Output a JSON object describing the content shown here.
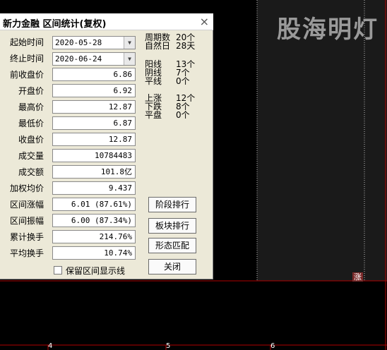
{
  "watermark": "股海明灯",
  "tag": "涨",
  "axis": {
    "labels": [
      "4",
      "5",
      "6"
    ]
  },
  "dialog": {
    "title": "新力金融 区间统计(复权)",
    "close": "×",
    "start_label": "起始时间",
    "start_value": "2020-05-28",
    "end_label": "终止时间",
    "end_value": "2020-06-24",
    "fields": [
      {
        "label": "前收盘价",
        "value": "6.86"
      },
      {
        "label": "开盘价",
        "value": "6.92"
      },
      {
        "label": "最高价",
        "value": "12.87"
      },
      {
        "label": "最低价",
        "value": "6.87"
      },
      {
        "label": "收盘价",
        "value": "12.87"
      },
      {
        "label": "成交量",
        "value": "10784483"
      },
      {
        "label": "成交额",
        "value": "101.8亿"
      },
      {
        "label": "加权均价",
        "value": "9.437"
      },
      {
        "label": "区间涨幅",
        "value": "6.01 (87.61%)"
      },
      {
        "label": "区间振幅",
        "value": "6.00 (87.34%)"
      },
      {
        "label": "累计换手",
        "value": "214.76%"
      },
      {
        "label": "平均换手",
        "value": "10.74%"
      }
    ],
    "period": [
      {
        "k": "周期数",
        "v": "20个"
      },
      {
        "k": "自然日",
        "v": "28天"
      }
    ],
    "lines": [
      {
        "k": "阳线",
        "v": "13个"
      },
      {
        "k": "阴线",
        "v": "7个"
      },
      {
        "k": "平线",
        "v": "0个"
      }
    ],
    "moves": [
      {
        "k": "上涨",
        "v": "12个"
      },
      {
        "k": "下跌",
        "v": "8个"
      },
      {
        "k": "平盘",
        "v": "0个"
      }
    ],
    "buttons": [
      "阶段排行",
      "板块排行",
      "形态匹配",
      "关闭"
    ],
    "checkbox_label": "保留区间显示线"
  }
}
